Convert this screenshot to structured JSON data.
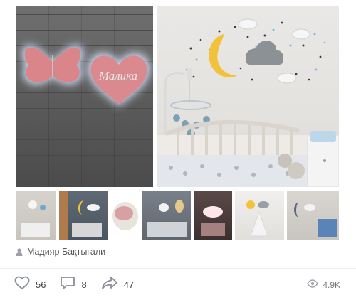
{
  "post": {
    "author": "Мадияр Бақтығали",
    "photo_main_1": {
      "heart_text": "Малика"
    },
    "actions": {
      "likes": "56",
      "comments": "8",
      "shares": "47"
    },
    "views": "4.9K"
  },
  "icons": {
    "author": "person-icon",
    "like": "heart-icon",
    "comment": "comment-icon",
    "share": "share-arrow-icon",
    "views": "eye-icon"
  },
  "colors": {
    "icon_gray": "#8a8f96",
    "text_gray": "#5b5b5b",
    "glow": "#cfe0ff",
    "pink": "#d57f84",
    "moon": "#f1c23a",
    "cloud": "#8b9194"
  }
}
